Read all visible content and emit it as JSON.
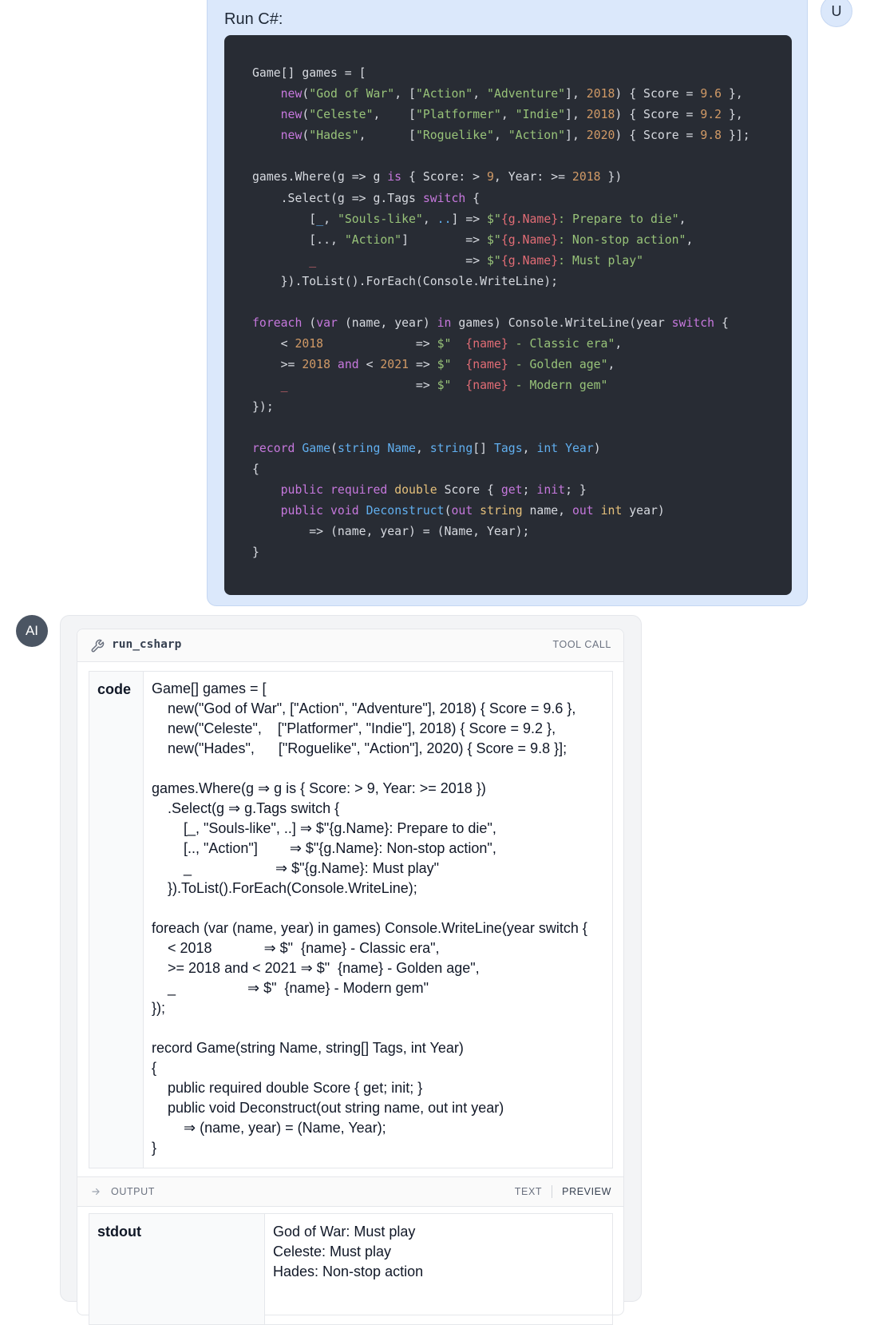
{
  "user_message": {
    "avatar": "U",
    "title": "Run C#:"
  },
  "ai_message": {
    "avatar": "AI",
    "tool_name": "run_csharp",
    "tool_tag": "TOOL CALL",
    "arg_key": "code",
    "arg_value": "Game[] games = [\n    new(\"God of War\", [\"Action\", \"Adventure\"], 2018) { Score = 9.6 },\n    new(\"Celeste\",    [\"Platformer\", \"Indie\"], 2018) { Score = 9.2 },\n    new(\"Hades\",      [\"Roguelike\", \"Action\"], 2020) { Score = 9.8 }];\n\ngames.Where(g ⇒ g is { Score: > 9, Year: >= 2018 })\n    .Select(g ⇒ g.Tags switch {\n        [_, \"Souls-like\", ..] ⇒ $\"{g.Name}: Prepare to die\",\n        [.., \"Action\"]        ⇒ $\"{g.Name}: Non-stop action\",\n        _                     ⇒ $\"{g.Name}: Must play\"\n    }).ToList().ForEach(Console.WriteLine);\n\nforeach (var (name, year) in games) Console.WriteLine(year switch {\n    < 2018             ⇒ $\"  {name} - Classic era\",\n    >= 2018 and < 2021 ⇒ $\"  {name} - Golden age\",\n    _                  ⇒ $\"  {name} - Modern gem\"\n});\n\nrecord Game(string Name, string[] Tags, int Year)\n{\n    public required double Score { get; init; }\n    public void Deconstruct(out string name, out int year)\n        ⇒ (name, year) = (Name, Year);\n}",
    "output_label": "OUTPUT",
    "tab_text": "TEXT",
    "tab_preview": "PREVIEW",
    "stdout_key": "stdout",
    "stdout_value": "God of War: Must play\nCeleste: Must play\nHades: Non-stop action"
  },
  "icons": {
    "wrench": "wrench-icon",
    "output": "arrow-right-icon"
  }
}
